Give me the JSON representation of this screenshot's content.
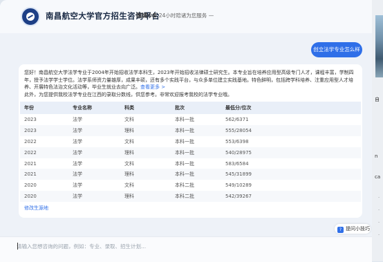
{
  "header": {
    "title": "南昌航空大学官方招生咨询平台",
    "brand": "国城小E",
    "service": "· 24小时陪诸为您服务 —"
  },
  "chat": {
    "user_message": "创立法学专业怎么样",
    "answer": {
      "paragraph": "您好！南昌航空大学法学专业于2004年开始招收法学本科生，2023年开始招收法律硕士研究生。本专业旨在培养应用型高级专门人才，课程丰富，学制四年，授予法学学士学位。法学系师资力量雄厚，成果丰硕，还有多个实践平台，与众多单位建立实践基地。特色鲜明，包括跨学科培养、注重应用型人才培养、开展特色法治文化活动等，毕业生就业去向广泛。",
      "more_link": "查看更多 >",
      "intro": "此外，为您提供我校法学专业在江西的录取分数线，供您参考。非常欢迎报考我校的法学专业哦。",
      "table": {
        "headers": [
          "年份",
          "专业名称",
          "科类",
          "批次",
          "最低分/位次"
        ],
        "rows": [
          [
            "2023",
            "法学",
            "文科",
            "本科一批",
            "562/6371"
          ],
          [
            "2023",
            "法学",
            "理科",
            "本科一批",
            "555/28054"
          ],
          [
            "2022",
            "法学",
            "文科",
            "本科一批",
            "553/6398"
          ],
          [
            "2022",
            "法学",
            "理科",
            "本科一批",
            "540/28975"
          ],
          [
            "2021",
            "法学",
            "文科",
            "本科一批",
            "583/6584"
          ],
          [
            "2021",
            "法学",
            "理科",
            "本科一批",
            "545/31899"
          ],
          [
            "2020",
            "法学",
            "文科",
            "本科二批",
            "549/10289"
          ],
          [
            "2020",
            "法学",
            "理科",
            "本科二批",
            "542/39267"
          ]
        ]
      },
      "source_link": "修改生源地"
    }
  },
  "tips_button": "提问小技巧",
  "input": {
    "placeholder": "请输入您想咨询的问题，例如：专业、录取、招生计划..."
  },
  "side_panel": {
    "chars": [
      "自",
      "n",
      "ca"
    ]
  },
  "colors": {
    "accent": "#2f6fe8",
    "logo": "#1d3f86",
    "background": "#eef2f8"
  }
}
